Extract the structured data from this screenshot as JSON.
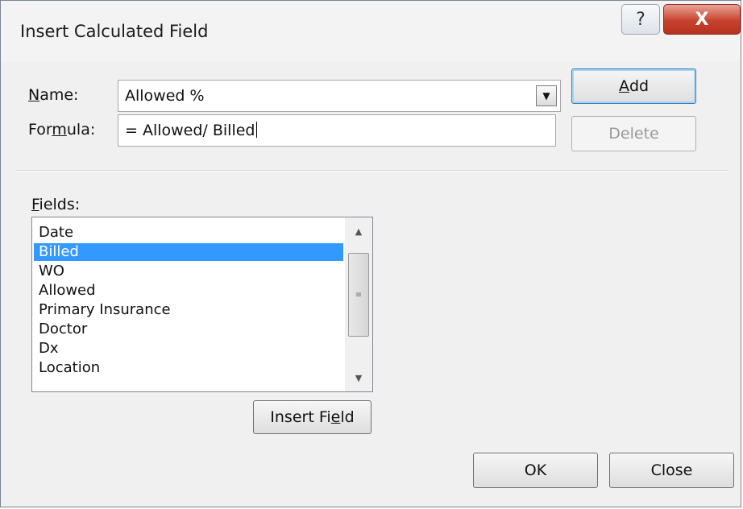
{
  "window": {
    "title": "Insert Calculated Field",
    "help_label": "?",
    "close_label": "X"
  },
  "name_field": {
    "label_u": "N",
    "label_rest": "ame:",
    "value": "Allowed %"
  },
  "formula_field": {
    "label_pre": "For",
    "label_u": "m",
    "label_post": "ula:",
    "value": "= Allowed/ Billed"
  },
  "buttons": {
    "add_u": "A",
    "add_rest": "dd",
    "delete": "Delete",
    "insert_pre": "Insert Fi",
    "insert_u": "e",
    "insert_post": "ld",
    "ok": "OK",
    "close": "Close"
  },
  "fields": {
    "label_u": "F",
    "label_rest": "ields:",
    "items": [
      "Date",
      "Billed",
      "WO",
      "Allowed",
      "Primary Insurance",
      "Doctor",
      "Dx",
      "Location"
    ],
    "selected": "Billed"
  },
  "colors": {
    "selection": "#3399ff",
    "close_button": "#c8432f"
  }
}
